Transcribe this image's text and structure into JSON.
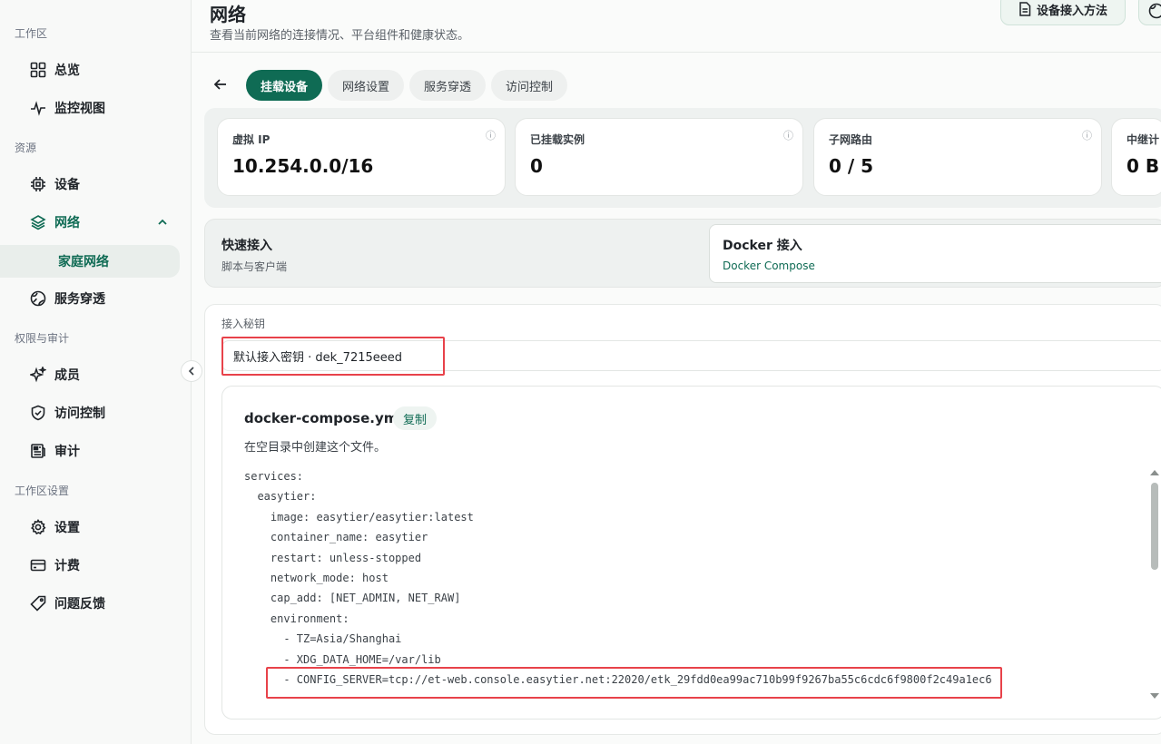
{
  "sidebar": {
    "groups": {
      "workspace": "工作区",
      "resources": "资源",
      "permissions": "权限与审计",
      "settings": "工作区设置"
    },
    "items": {
      "overview": "总览",
      "monitor": "监控视图",
      "devices": "设备",
      "network": "网络",
      "home_network": "家庭网络",
      "service_tunnel": "服务穿透",
      "members": "成员",
      "access_control": "访问控制",
      "audit": "审计",
      "settings": "设置",
      "billing": "计费",
      "feedback": "问题反馈"
    }
  },
  "header": {
    "title": "网络",
    "description": "查看当前网络的连接情况、平台组件和健康状态。",
    "device_access_button": "设备接入方法"
  },
  "tabs": [
    "挂载设备",
    "网络设置",
    "服务穿透",
    "访问控制"
  ],
  "stats": [
    {
      "label": "虚拟 IP",
      "value": "10.254.0.0/16"
    },
    {
      "label": "已挂载实例",
      "value": "0"
    },
    {
      "label": "子网路由",
      "value": "0 / 5"
    },
    {
      "label": "中继计",
      "value": "0 B"
    }
  ],
  "quick_access": {
    "title": "快速接入",
    "subtitle": "脚本与客户端",
    "docker_title": "Docker 接入",
    "docker_subtitle": "Docker Compose"
  },
  "secret": {
    "label": "接入秘钥",
    "selected": "默认接入密钥 · dek_7215eeed"
  },
  "compose": {
    "filename": "docker-compose.yml",
    "copy_label": "复制",
    "description": "在空目录中创建这个文件。",
    "lines": [
      "services:",
      "  easytier:",
      "    image: easytier/easytier:latest",
      "    container_name: easytier",
      "    restart: unless-stopped",
      "    network_mode: host",
      "    cap_add: [NET_ADMIN, NET_RAW]",
      "    environment:",
      "      - TZ=Asia/Shanghai",
      "      - XDG_DATA_HOME=/var/lib",
      "      - CONFIG_SERVER=tcp://et-web.console.easytier.net:22020/etk_29fdd0ea99ac710b99f9267ba55c6cdc6f9800f2c49a1ec6"
    ]
  },
  "colors": {
    "accent": "#0f6b54",
    "highlight": "#e8424a"
  }
}
